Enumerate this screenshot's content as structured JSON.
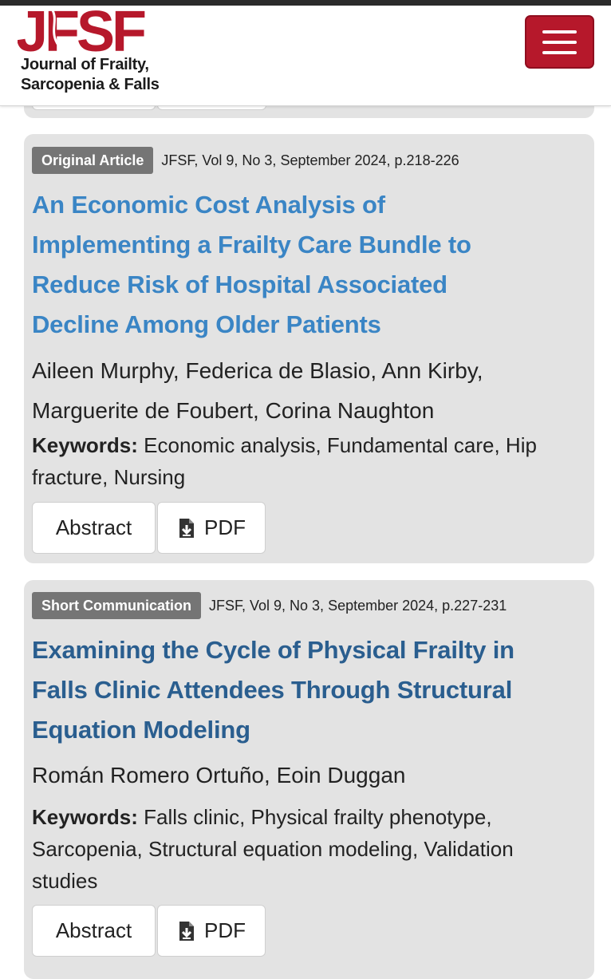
{
  "header": {
    "logo_text": "JFSF",
    "journal_line1": "Journal of Frailty,",
    "journal_line2": "Sarcopenia & Falls",
    "menu_icon": "hamburger-menu-icon",
    "brand_color": "#b6182b"
  },
  "articles": [
    {
      "type": "Original Article",
      "citation": "JFSF, Vol 9, No 3, September 2024, p.218-226",
      "title_lines": [
        "An Economic Cost Analysis of",
        "Implementing a Frailty Care Bundle to",
        "Reduce Risk of Hospital Associated",
        "Decline Among Older Patients"
      ],
      "authors_lines": [
        "Aileen Murphy, Federica de Blasio, Ann Kirby,",
        "Marguerite de Foubert, Corina Naughton"
      ],
      "keywords_label": "Keywords:",
      "keywords_lines": [
        "Economic analysis, Fundamental care, Hip",
        "fracture, Nursing"
      ],
      "abstract_label": "Abstract",
      "pdf_label": "PDF"
    },
    {
      "type": "Short Communication",
      "citation": "JFSF, Vol 9, No 3, September 2024, p.227-231",
      "title_lines": [
        "Examining the Cycle of Physical Frailty in",
        "Falls Clinic Attendees Through Structural",
        "Equation Modeling"
      ],
      "authors_lines": [
        "Román Romero Ortuño, Eoin Duggan"
      ],
      "keywords_label": "Keywords:",
      "keywords_lines": [
        "Falls clinic, Physical frailty phenotype,",
        "Sarcopenia, Structural equation modeling, Validation",
        "studies"
      ],
      "abstract_label": "Abstract",
      "pdf_label": "PDF"
    }
  ],
  "colors": {
    "title_link": "#3a85c5",
    "title_link_visited": "#2a5e8f",
    "badge_bg": "#757575",
    "card_bg": "#e3e3e3"
  }
}
